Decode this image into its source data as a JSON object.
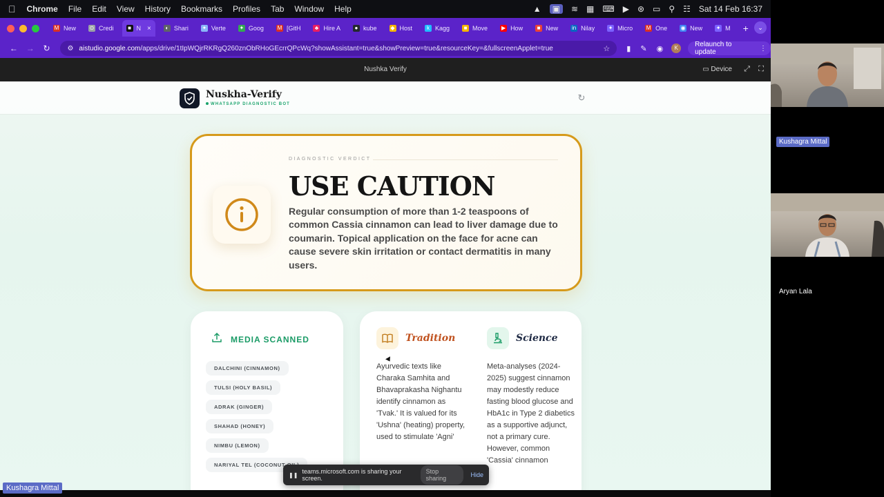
{
  "menubar": {
    "app": "Chrome",
    "menus": [
      "File",
      "Edit",
      "View",
      "History",
      "Bookmarks",
      "Profiles",
      "Tab",
      "Window",
      "Help"
    ],
    "clock": "Sat 14 Feb  16:37"
  },
  "tabs": [
    {
      "label": "New",
      "color": "#d93025",
      "fav": "M"
    },
    {
      "label": "Credi",
      "color": "#9aa0a6",
      "fav": "⊙"
    },
    {
      "label": "N",
      "color": "#111111",
      "fav": "■",
      "active": true
    },
    {
      "label": "Shari",
      "color": "#5f6368",
      "fav": "◐"
    },
    {
      "label": "Verte",
      "color": "#8ab4f8",
      "fav": "✦"
    },
    {
      "label": "Goog",
      "color": "#34a853",
      "fav": "✦"
    },
    {
      "label": "[GitH",
      "color": "#d93025",
      "fav": "M"
    },
    {
      "label": "Hire A",
      "color": "#e91e63",
      "fav": "♣"
    },
    {
      "label": "kube",
      "color": "#24292e",
      "fav": "●"
    },
    {
      "label": "Host",
      "color": "#f4b400",
      "fav": "◆"
    },
    {
      "label": "Kagg",
      "color": "#20beff",
      "fav": "k"
    },
    {
      "label": "Move",
      "color": "#f4b400",
      "fav": "■"
    },
    {
      "label": "How",
      "color": "#ff0000",
      "fav": "▶"
    },
    {
      "label": "New",
      "color": "#ea4335",
      "fav": "■"
    },
    {
      "label": "Nilay",
      "color": "#0a66c2",
      "fav": "in"
    },
    {
      "label": "Micro",
      "color": "#7b61ff",
      "fav": "✦"
    },
    {
      "label": "One",
      "color": "#d93025",
      "fav": "M"
    },
    {
      "label": "New",
      "color": "#4285f4",
      "fav": "◉"
    },
    {
      "label": "M",
      "color": "#7b61ff",
      "fav": "✦"
    }
  ],
  "omnibox": {
    "host": "aistudio.google.com",
    "path": "/apps/drive/1tIpWQjrRKRgQ260znObRHoGEcrrQPcWq?showAssistant=true&showPreview=true&resourceKey=&fullscreenApplet=true"
  },
  "relaunch_label": "Relaunch to update",
  "avatar_letter": "K",
  "appbar": {
    "title": "Nushka Verify",
    "device": "Device"
  },
  "brand": {
    "name": "Nuskha-Verify",
    "tagline": "WHATSAPP DIAGNOSTIC BOT"
  },
  "verdict": {
    "kicker": "DIAGNOSTIC VERDICT",
    "headline": "USE CAUTION",
    "body": "Regular consumption of more than 1-2 teaspoons of common Cassia cinnamon can lead to liver damage due to coumarin. Topical application on the face for acne can cause severe skin irritation or contact dermatitis in many users.",
    "accent": "#d69a1b"
  },
  "media": {
    "label": "MEDIA SCANNED",
    "items": [
      "DALCHINI (CINNAMON)",
      "TULSI (HOLY BASIL)",
      "ADRAK (GINGER)",
      "SHAHAD (HONEY)",
      "NIMBU (LEMON)",
      "NARIYAL TEL (COCONUT OIL)"
    ]
  },
  "tradition": {
    "title": "Tradition",
    "color": "#c0521f",
    "text": "Ayurvedic texts like Charaka Samhita and Bhavaprakasha Nighantu identify cinnamon as 'Tvak.' It is valued for its 'Ushna' (heating) property, used to stimulate 'Agni'"
  },
  "science": {
    "title": "Science",
    "color": "#1f2a44",
    "text": "Meta-analyses (2024-2025) suggest cinnamon may modestly reduce fasting blood glucose and HbA1c in Type 2 diabetics as a supportive adjunct, not a primary cure. However, common 'Cassia' cinnamon"
  },
  "share": {
    "text": "teams.microsoft.com is sharing your screen.",
    "stop": "Stop sharing",
    "hide": "Hide"
  },
  "participants": [
    "Kushagra Mittal",
    "Aryan Lala"
  ],
  "self_name": "Kushagra Mittal"
}
